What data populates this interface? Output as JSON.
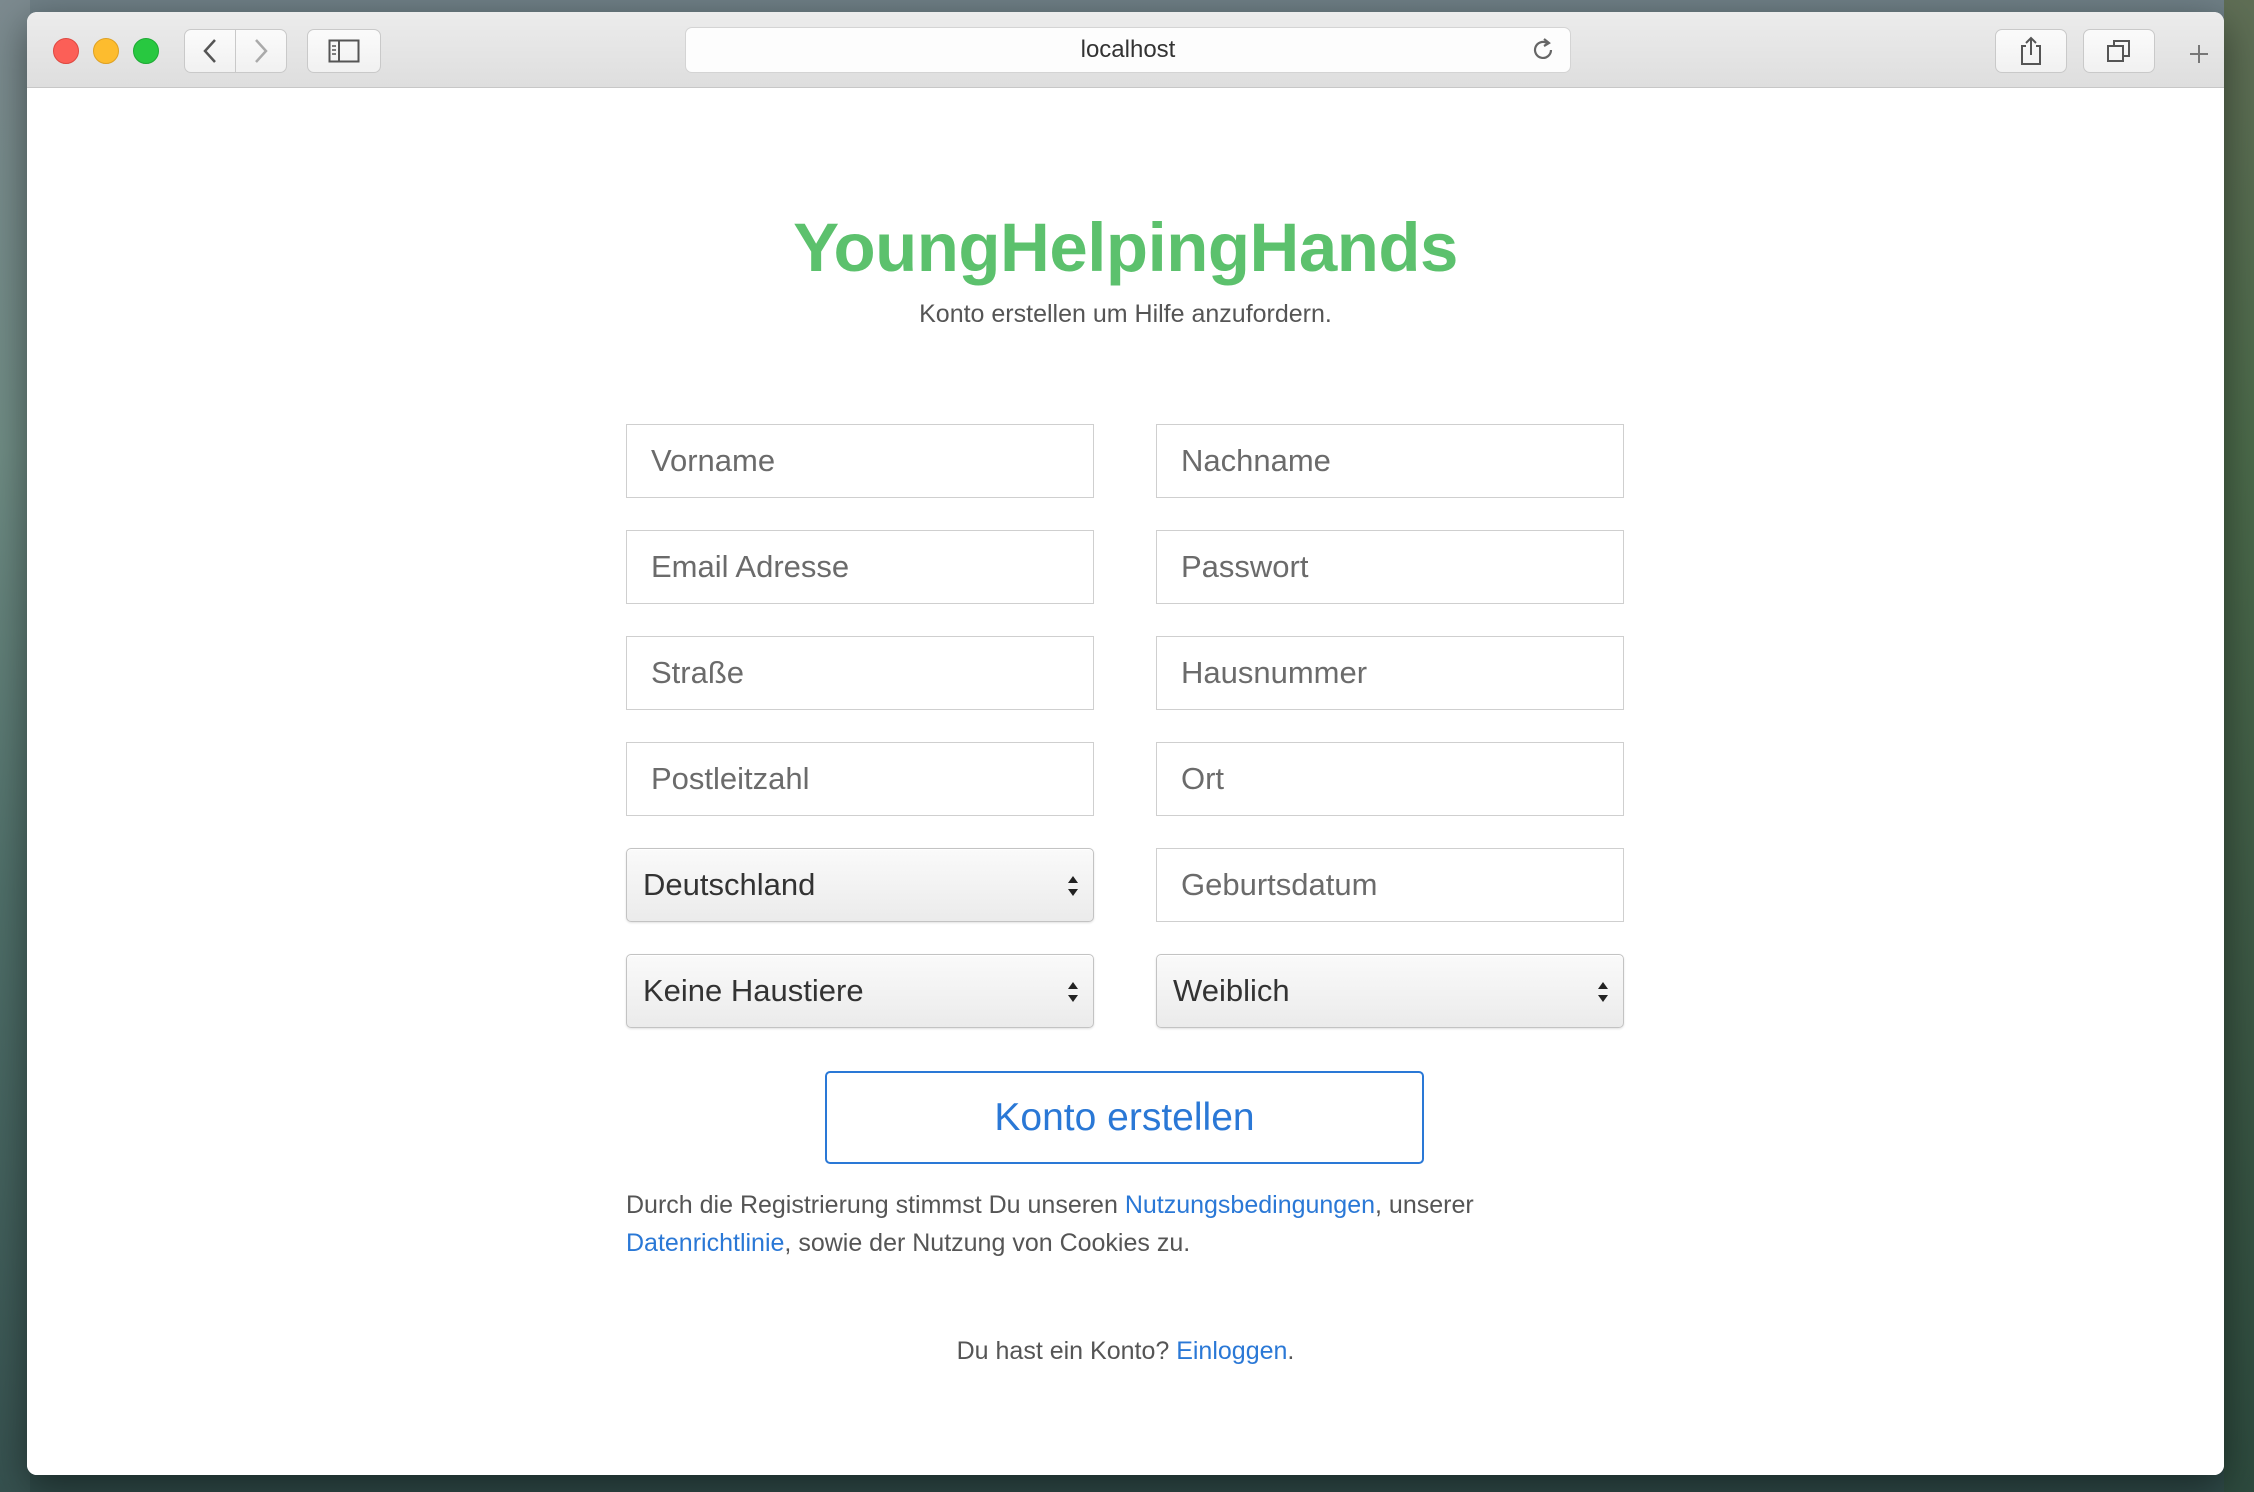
{
  "browser": {
    "address": "localhost"
  },
  "page": {
    "brand": "YoungHelpingHands",
    "subtitle": "Konto erstellen um Hilfe anzufordern.",
    "form": {
      "first_name": {
        "placeholder": "Vorname",
        "value": ""
      },
      "last_name": {
        "placeholder": "Nachname",
        "value": ""
      },
      "email": {
        "placeholder": "Email Adresse",
        "value": ""
      },
      "password": {
        "placeholder": "Passwort",
        "value": ""
      },
      "street": {
        "placeholder": "Straße",
        "value": ""
      },
      "house_number": {
        "placeholder": "Hausnummer",
        "value": ""
      },
      "postal_code": {
        "placeholder": "Postleitzahl",
        "value": ""
      },
      "city": {
        "placeholder": "Ort",
        "value": ""
      },
      "country": {
        "selected": "Deutschland"
      },
      "birthdate": {
        "placeholder": "Geburtsdatum",
        "value": ""
      },
      "pets": {
        "selected": "Keine Haustiere"
      },
      "gender": {
        "selected": "Weiblich"
      },
      "submit_label": "Konto erstellen"
    },
    "terms": {
      "prefix": "Durch die Registrierung stimmst Du unseren ",
      "terms_link": "Nutzungsbedingungen",
      "middle": ", unserer",
      "privacy_link": "Datenrichtlinie",
      "suffix": ", sowie der Nutzung von Cookies zu."
    },
    "login": {
      "prefix": "Du hast ein Konto? ",
      "link": "Einloggen",
      "suffix": "."
    }
  },
  "colors": {
    "brand_green": "#5cc16d",
    "link_blue": "#2a78d6"
  }
}
